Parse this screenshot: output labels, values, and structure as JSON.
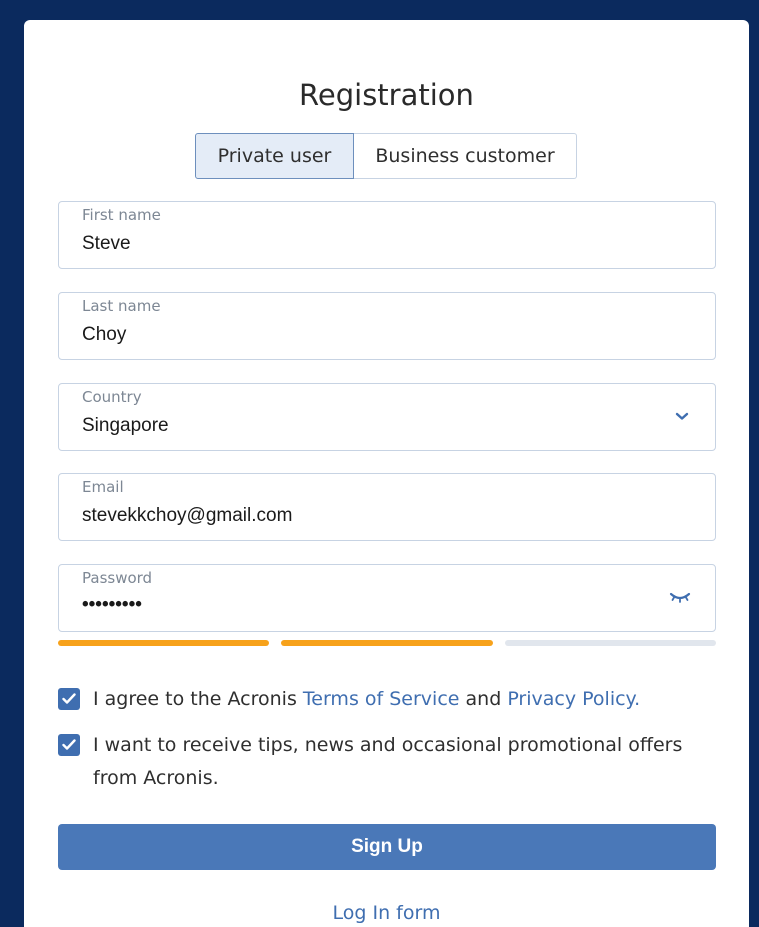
{
  "form": {
    "title": "Registration",
    "tabs": [
      {
        "label": "Private user",
        "active": true
      },
      {
        "label": "Business customer",
        "active": false
      }
    ],
    "fields": {
      "first_name": {
        "label": "First name",
        "value": "Steve"
      },
      "last_name": {
        "label": "Last name",
        "value": "Choy"
      },
      "country": {
        "label": "Country",
        "value": "Singapore",
        "icon": "chevron-down-icon"
      },
      "email": {
        "label": "Email",
        "value": "stevekkchoy@gmail.com"
      },
      "password": {
        "label": "Password",
        "value": "•••••••••",
        "icon": "eye-closed-icon"
      }
    },
    "password_strength": {
      "level": 2,
      "max": 3,
      "filled_color": "#f7a21b",
      "empty_color": "#e1e6ed"
    },
    "terms": {
      "checked": true,
      "prefix": "I agree to the Acronis",
      "terms_link": "Terms of Service",
      "middle": "and",
      "privacy_link": "Privacy Policy."
    },
    "newsletter": {
      "checked": true,
      "text": "I want to receive tips, news and occasional promotional offers from Acronis."
    },
    "signup_label": "Sign Up",
    "login_link": "Log In form"
  },
  "colors": {
    "background": "#0b2a5e",
    "accent": "#4a78b8",
    "link": "#3f6eb0"
  }
}
